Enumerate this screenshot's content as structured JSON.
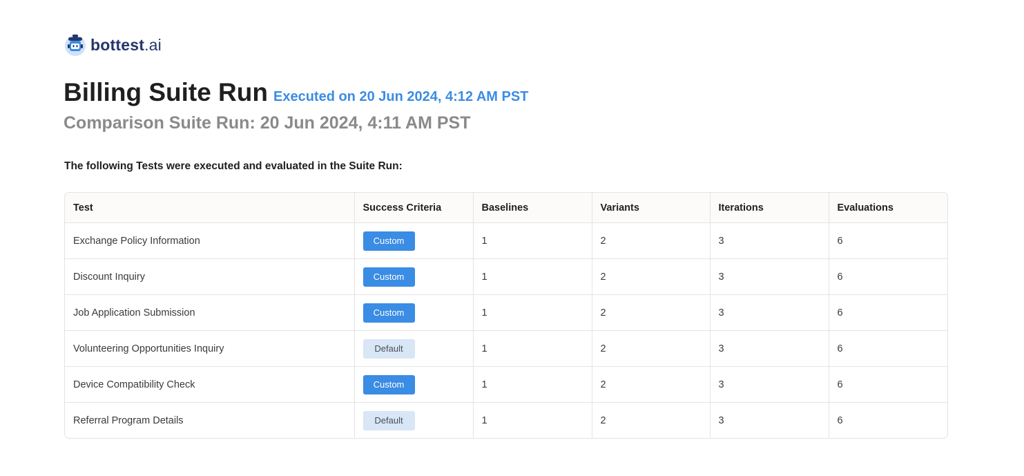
{
  "brand": {
    "name": "bottest",
    "suffix": ".ai",
    "logo_icon": "robot-icon",
    "color": "#25366b"
  },
  "header": {
    "title": "Billing Suite Run",
    "executed": "Executed on 20 Jun 2024, 4:12 AM PST",
    "comparison": "Comparison Suite Run: 20 Jun 2024, 4:11 AM PST"
  },
  "intro": "The following Tests were executed and evaluated in the Suite Run:",
  "colors": {
    "accent": "#3a8ce4",
    "default_badge_bg": "#d8e6f6",
    "subtitle": "#8a8a8a"
  },
  "table": {
    "columns": [
      "Test",
      "Success Criteria",
      "Baselines",
      "Variants",
      "Iterations",
      "Evaluations"
    ],
    "rows": [
      {
        "test": "Exchange Policy Information",
        "criteria": "Custom",
        "baselines": "1",
        "variants": "2",
        "iterations": "3",
        "evaluations": "6"
      },
      {
        "test": "Discount Inquiry",
        "criteria": "Custom",
        "baselines": "1",
        "variants": "2",
        "iterations": "3",
        "evaluations": "6"
      },
      {
        "test": "Job Application Submission",
        "criteria": "Custom",
        "baselines": "1",
        "variants": "2",
        "iterations": "3",
        "evaluations": "6"
      },
      {
        "test": "Volunteering Opportunities Inquiry",
        "criteria": "Default",
        "baselines": "1",
        "variants": "2",
        "iterations": "3",
        "evaluations": "6"
      },
      {
        "test": "Device Compatibility Check",
        "criteria": "Custom",
        "baselines": "1",
        "variants": "2",
        "iterations": "3",
        "evaluations": "6"
      },
      {
        "test": "Referral Program Details",
        "criteria": "Default",
        "baselines": "1",
        "variants": "2",
        "iterations": "3",
        "evaluations": "6"
      }
    ]
  }
}
